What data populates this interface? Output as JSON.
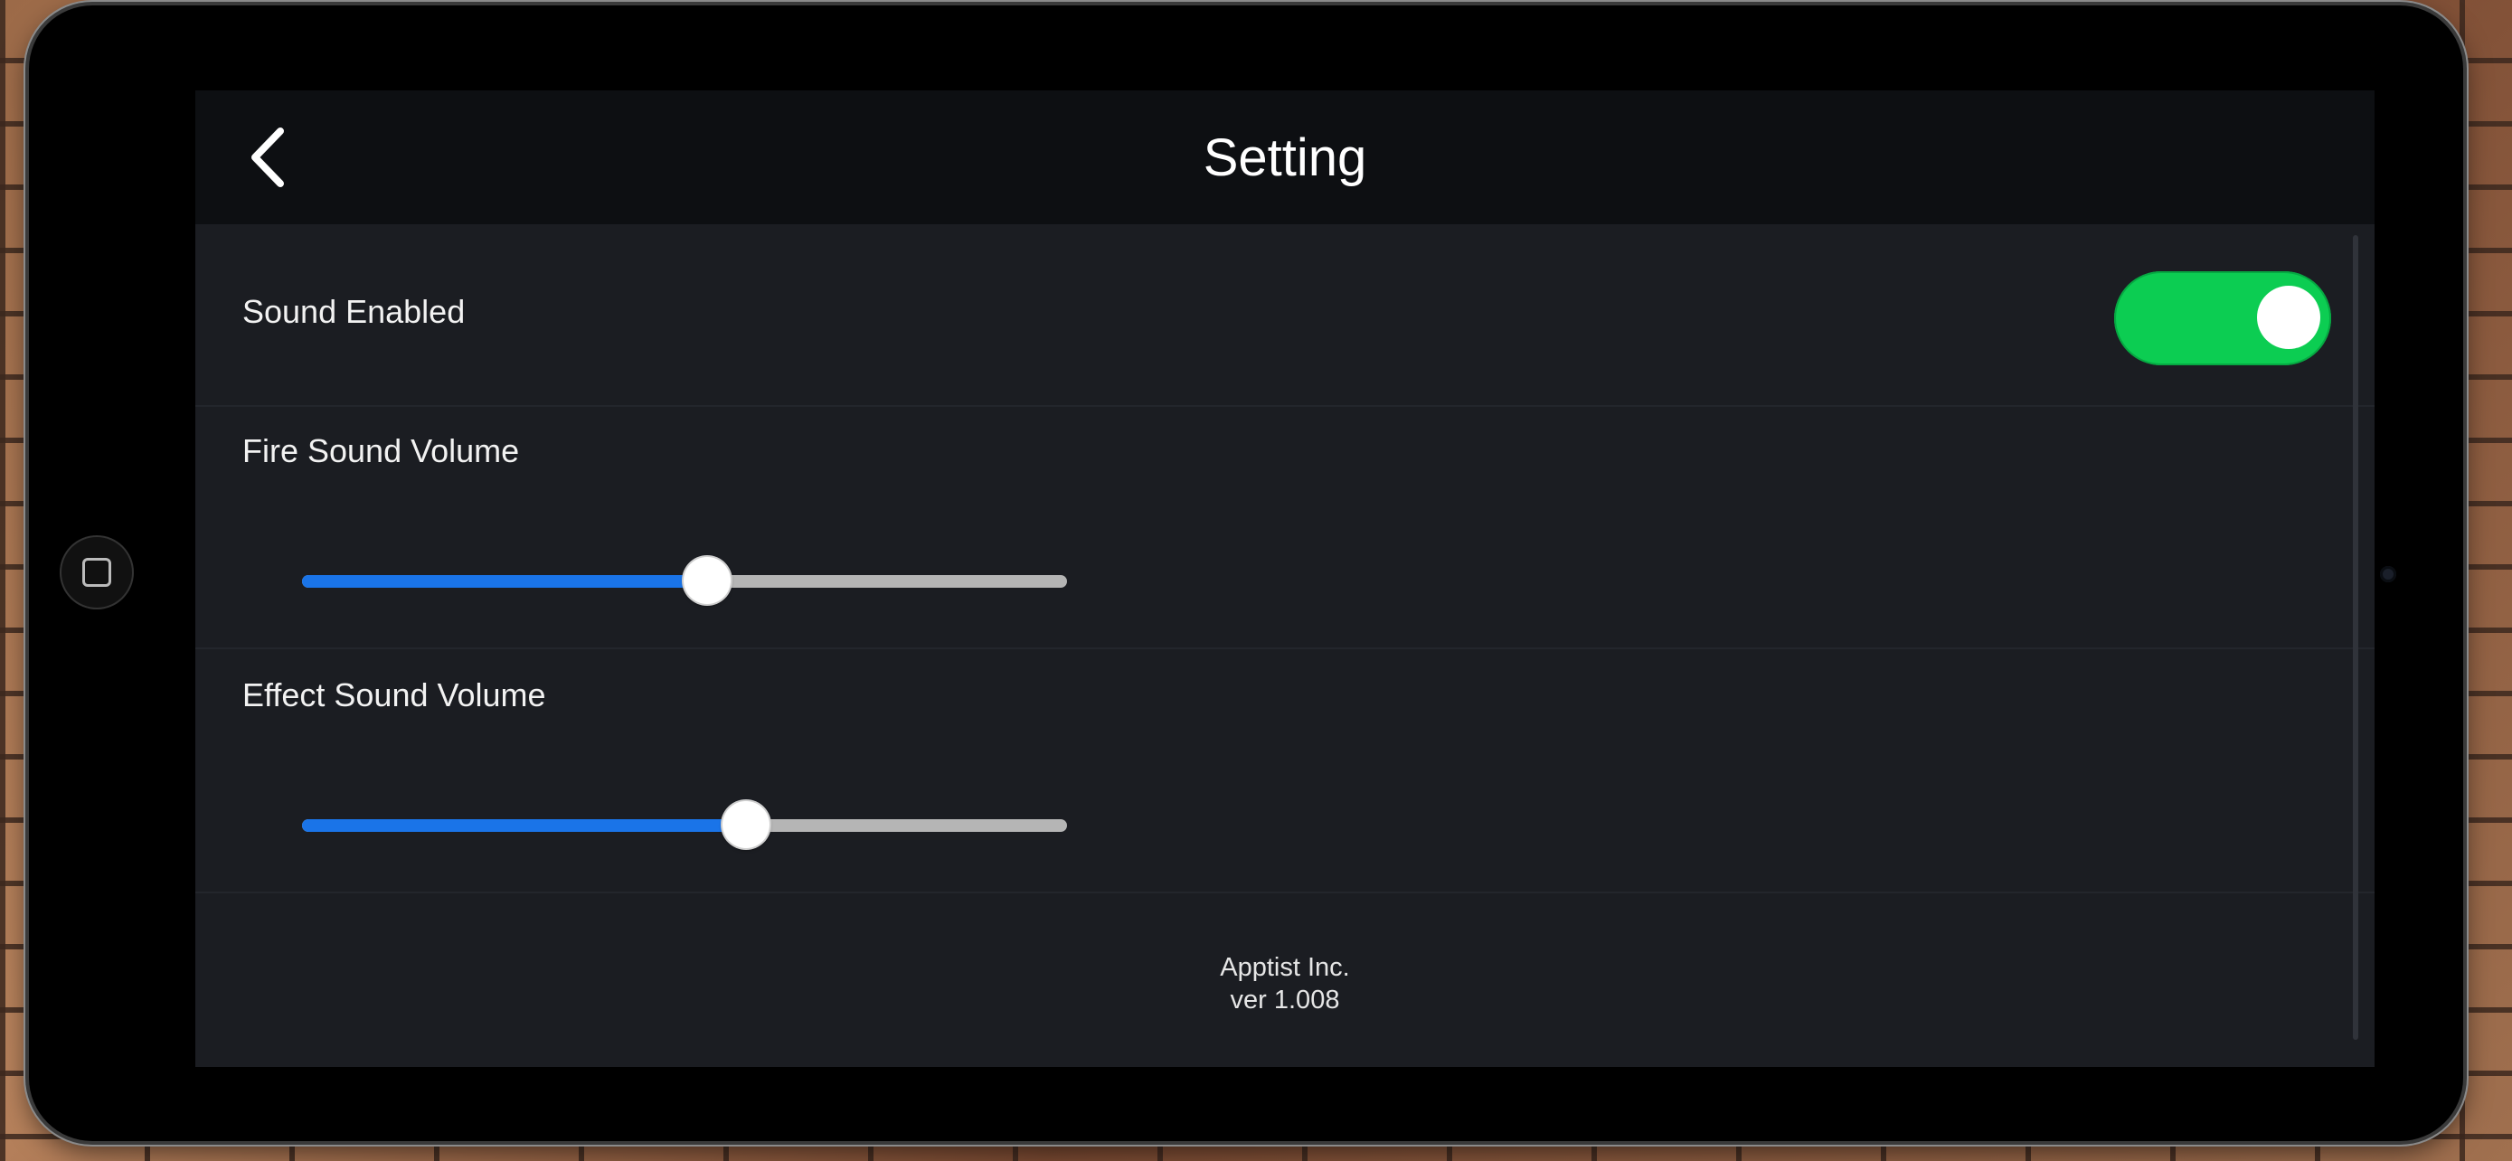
{
  "header": {
    "title": "Setting",
    "back_icon": "chevron-left-icon"
  },
  "settings": {
    "sound_enabled": {
      "label": "Sound Enabled",
      "value": true,
      "on_color": "#0ccd52"
    },
    "fire_sound_volume": {
      "label": "Fire Sound Volume",
      "value": 0.53
    },
    "effect_sound_volume": {
      "label": "Effect Sound Volume",
      "value": 0.58
    },
    "slider_fill_color": "#1a74e8",
    "slider_track_color": "#b5b5b5"
  },
  "footer": {
    "company": "Apptist Inc.",
    "version": "ver 1.008"
  },
  "device": {
    "home_icon": "home-square-icon"
  }
}
